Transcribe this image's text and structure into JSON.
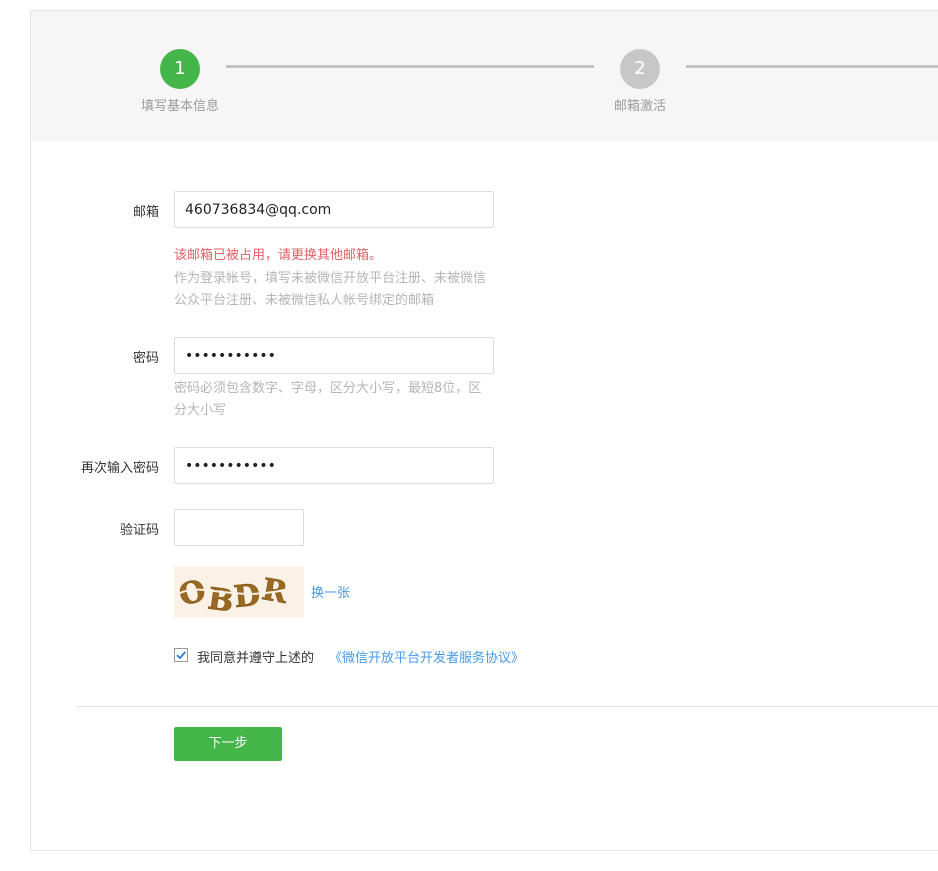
{
  "steps": [
    {
      "number": "1",
      "label": "填写基本信息",
      "state": "active"
    },
    {
      "number": "2",
      "label": "邮箱激活",
      "state": "inactive"
    }
  ],
  "form": {
    "email": {
      "label": "邮箱",
      "value": "460736834@qq.com",
      "error": "该邮箱已被占用，请更换其他邮箱。",
      "tip": "作为登录帐号，填写未被微信开放平台注册、未被微信公众平台注册、未被微信私人帐号绑定的邮箱"
    },
    "password": {
      "label": "密码",
      "value": "•••••••••••",
      "tip": "密码必须包含数字、字母，区分大小写，最短8位，区分大小写"
    },
    "confirm_password": {
      "label": "再次输入密码",
      "value": "•••••••••••"
    },
    "captcha": {
      "label": "验证码",
      "value": "",
      "image_text": "OBDR",
      "refresh_link": "换一张"
    },
    "agreement": {
      "checked": true,
      "text": "我同意并遵守上述的",
      "link": "《微信开放平台开发者服务协议》"
    },
    "next_button": "下一步"
  },
  "colors": {
    "accent": "#44b549",
    "error": "#e15f63",
    "link": "#459ae9"
  }
}
